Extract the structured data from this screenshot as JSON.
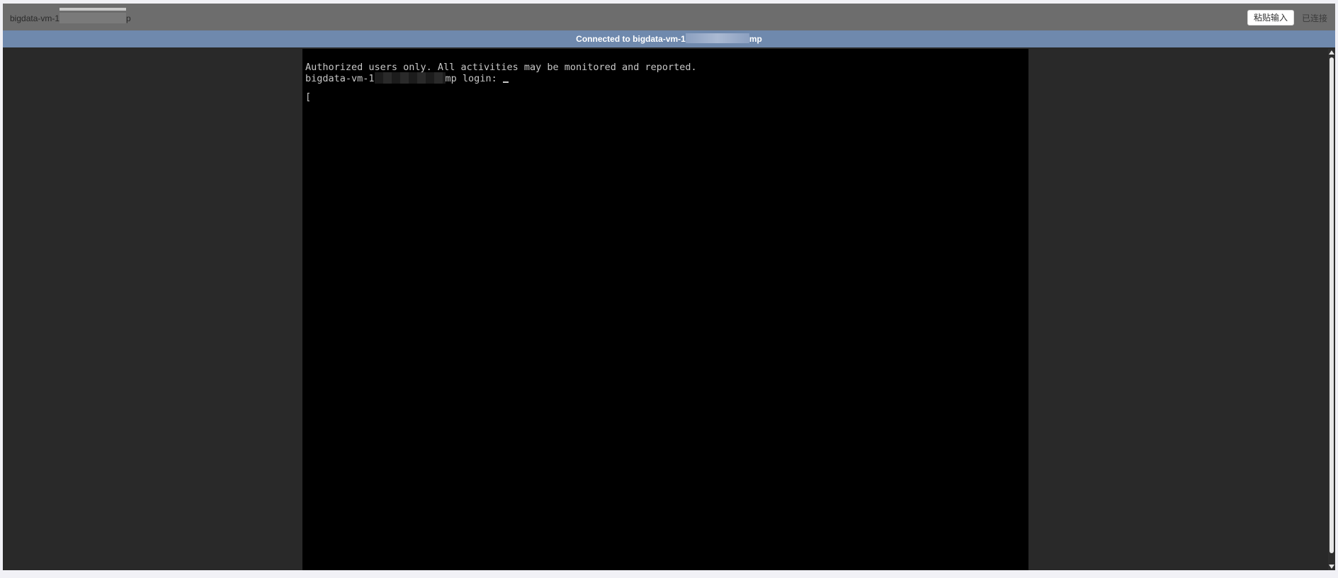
{
  "topbar": {
    "vm_name_prefix": "bigdata-vm-1",
    "vm_name_suffix": "p",
    "paste_button_label": "粘贴输入",
    "connection_status": "已连接"
  },
  "connection_banner": {
    "prefix": "Connected to bigdata-vm-1",
    "suffix": "mp"
  },
  "terminal": {
    "line1": "Authorized users only. All activities may be monitored and reported.",
    "line2_prefix": "bigdata-vm-1",
    "line2_suffix": "mp login: ",
    "line3": "["
  },
  "colors": {
    "topbar": "#6d6d6d",
    "connection_banner": "#6f89ad",
    "terminal_bg": "#000000",
    "side_bg": "#292929"
  }
}
